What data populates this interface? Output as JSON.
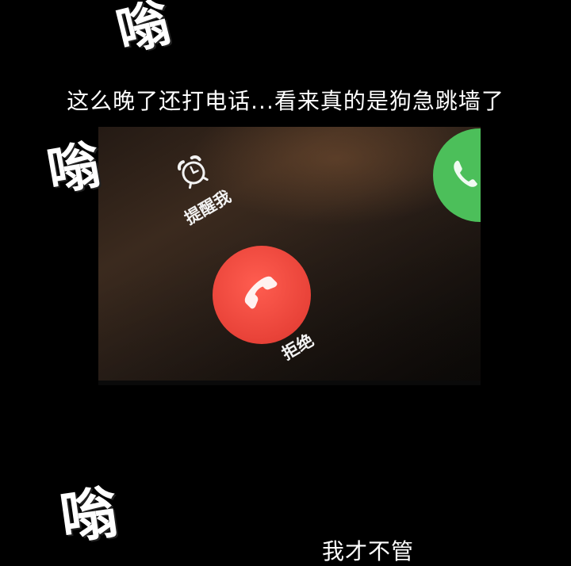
{
  "sound_effects": {
    "sfx1": "嗡",
    "sfx2": "嗡",
    "sfx3": "嗡"
  },
  "captions": {
    "top": "这么晚了还打电话...看来真的是狗急跳墙了",
    "bottom": "我才不管"
  },
  "incoming_call": {
    "remind_me_label": "提醒我",
    "decline_label": "拒绝",
    "decline_color": "#e84238",
    "accept_color": "#4cbf5a",
    "icons": [
      "alarm-clock-icon",
      "phone-hangup-icon",
      "phone-icon"
    ]
  }
}
